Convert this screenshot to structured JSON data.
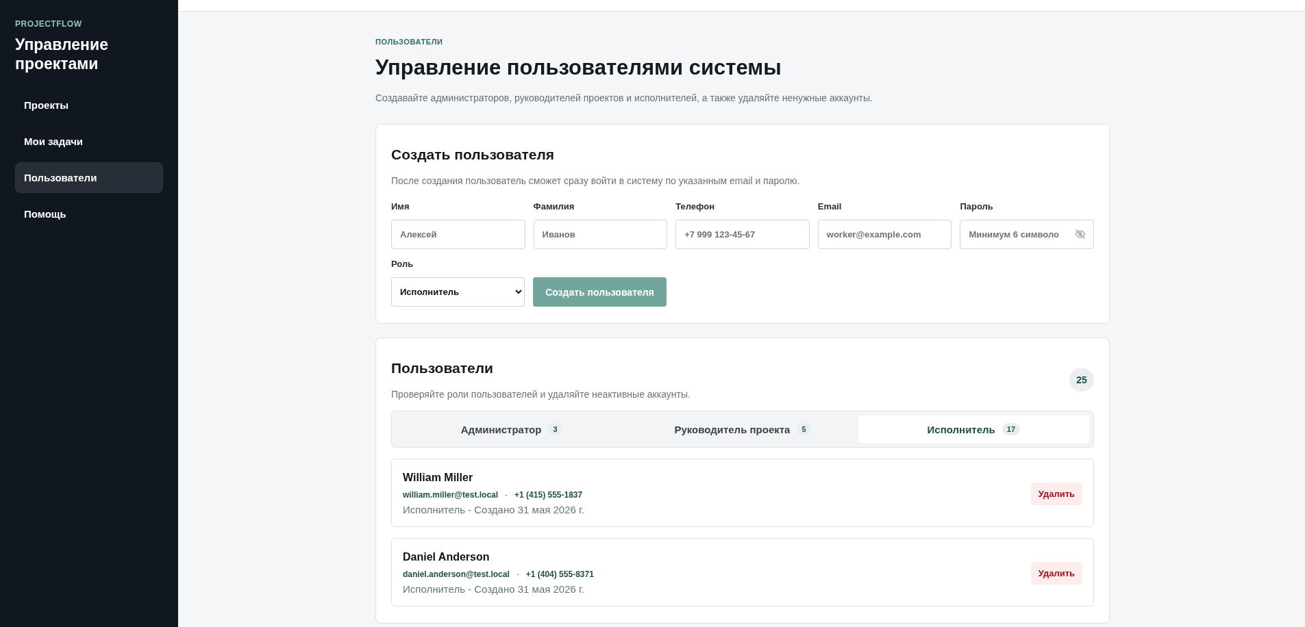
{
  "sidebar": {
    "brand": "PROJECTFLOW",
    "title": "Управление проектами",
    "items": [
      {
        "label": "Проекты",
        "selected": false
      },
      {
        "label": "Мои задачи",
        "selected": false
      },
      {
        "label": "Пользователи",
        "selected": true
      },
      {
        "label": "Помощь",
        "selected": false
      }
    ]
  },
  "header": {
    "eyebrow": "ПОЛЬЗОВАТЕЛИ",
    "title": "Управление пользователями системы",
    "subtitle": "Создавайте администраторов, руководителей проектов и исполнителей, а также удаляйте ненужные аккаунты."
  },
  "create_form": {
    "title": "Создать пользователя",
    "description": "После создания пользователь сможет сразу войти в систему по указанным email и паролю.",
    "fields": [
      {
        "label": "Имя",
        "placeholder": "Алексей",
        "kind": "text"
      },
      {
        "label": "Фамилия",
        "placeholder": "Иванов",
        "kind": "text"
      },
      {
        "label": "Телефон",
        "placeholder": "+7 999 123-45-67",
        "kind": "text"
      },
      {
        "label": "Email",
        "placeholder": "worker@example.com",
        "kind": "text"
      },
      {
        "label": "Пароль",
        "placeholder": "Минимум 6 символо",
        "kind": "password"
      }
    ],
    "role": {
      "label": "Роль",
      "value": "Исполнитель"
    },
    "submit": {
      "label": "Создать пользователя",
      "disabled": true
    }
  },
  "users_panel": {
    "title": "Пользователи",
    "description": "Проверяйте роли пользователей и удаляйте неактивные аккаунты.",
    "total": "25",
    "tabs": [
      {
        "label": "Администратор",
        "count": "3",
        "selected": false
      },
      {
        "label": "Руководитель проекта",
        "count": "5",
        "selected": false
      },
      {
        "label": "Исполнитель",
        "count": "17",
        "selected": true
      }
    ],
    "users": [
      {
        "name": "William Miller",
        "email": "william.miller@test.local",
        "separator": "-",
        "phone": "+1 (415) 555-1837",
        "meta": "Исполнитель - Создано 31 мая 2026 г.",
        "action": "Удалить"
      },
      {
        "name": "Daniel Anderson",
        "email": "daniel.anderson@test.local",
        "separator": "-",
        "phone": "+1 (404) 555-8371",
        "meta": "Исполнитель - Создано 31 мая 2026 г.",
        "action": "Удалить"
      }
    ]
  }
}
